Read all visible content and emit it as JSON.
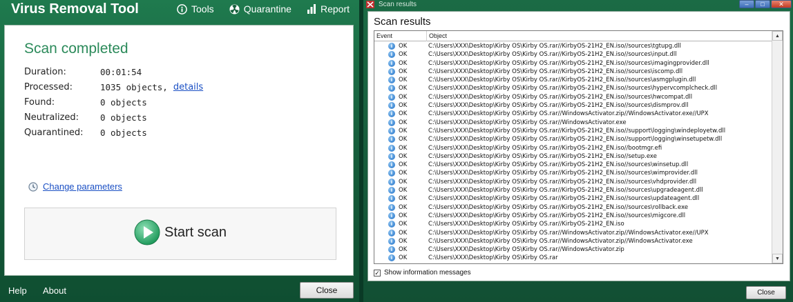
{
  "left_window": {
    "title": "Virus Removal Tool",
    "menu": [
      {
        "icon": "info-circle-icon",
        "label": "Tools"
      },
      {
        "icon": "radiation-icon",
        "label": "Quarantine"
      },
      {
        "icon": "bar-chart-icon",
        "label": "Report"
      }
    ],
    "heading": "Scan completed",
    "stats": [
      {
        "label": "Duration:",
        "value": "00:01:54",
        "link": ""
      },
      {
        "label": "Processed:",
        "value": "1035 objects,",
        "link": "details"
      },
      {
        "label": "Found:",
        "value": "0 objects",
        "link": ""
      },
      {
        "label": "Neutralized:",
        "value": "0 objects",
        "link": ""
      },
      {
        "label": "Quarantined:",
        "value": "0 objects",
        "link": ""
      }
    ],
    "change_parameters": "Change parameters",
    "start_scan": "Start scan",
    "footer": {
      "help": "Help",
      "about": "About",
      "close": "Close"
    },
    "colors": {
      "accent": "#2b8a5a",
      "background": "#17603d",
      "link": "#1a4fc4"
    }
  },
  "right_window": {
    "title": "Scan results",
    "heading": "Scan results",
    "columns": {
      "event": "Event",
      "object": "Object"
    },
    "rows": [
      {
        "event": "OK",
        "object": "C:\\Users\\XXX\\Desktop\\Kirby OS\\Kirby OS.rar//KirbyOS-21H2_EN.iso//sources\\tgtupg.dll"
      },
      {
        "event": "OK",
        "object": "C:\\Users\\XXX\\Desktop\\Kirby OS\\Kirby OS.rar//KirbyOS-21H2_EN.iso//sources\\input.dll"
      },
      {
        "event": "OK",
        "object": "C:\\Users\\XXX\\Desktop\\Kirby OS\\Kirby OS.rar//KirbyOS-21H2_EN.iso//sources\\imagingprovider.dll"
      },
      {
        "event": "OK",
        "object": "C:\\Users\\XXX\\Desktop\\Kirby OS\\Kirby OS.rar//KirbyOS-21H2_EN.iso//sources\\iscomp.dll"
      },
      {
        "event": "OK",
        "object": "C:\\Users\\XXX\\Desktop\\Kirby OS\\Kirby OS.rar//KirbyOS-21H2_EN.iso//sources\\asmgplugin.dll"
      },
      {
        "event": "OK",
        "object": "C:\\Users\\XXX\\Desktop\\Kirby OS\\Kirby OS.rar//KirbyOS-21H2_EN.iso//sources\\hypervcomplcheck.dll"
      },
      {
        "event": "OK",
        "object": "C:\\Users\\XXX\\Desktop\\Kirby OS\\Kirby OS.rar//KirbyOS-21H2_EN.iso//sources\\hwcompat.dll"
      },
      {
        "event": "OK",
        "object": "C:\\Users\\XXX\\Desktop\\Kirby OS\\Kirby OS.rar//KirbyOS-21H2_EN.iso//sources\\dismprov.dll"
      },
      {
        "event": "OK",
        "object": "C:\\Users\\XXX\\Desktop\\Kirby OS\\Kirby OS.rar//WindowsActivator.zip//WindowsActivator.exe//UPX"
      },
      {
        "event": "OK",
        "object": "C:\\Users\\XXX\\Desktop\\Kirby OS\\Kirby OS.rar//WindowsActivator.exe"
      },
      {
        "event": "OK",
        "object": "C:\\Users\\XXX\\Desktop\\Kirby OS\\Kirby OS.rar//KirbyOS-21H2_EN.iso//support\\logging\\windeployetw.dll"
      },
      {
        "event": "OK",
        "object": "C:\\Users\\XXX\\Desktop\\Kirby OS\\Kirby OS.rar//KirbyOS-21H2_EN.iso//support\\logging\\winsetupetw.dll"
      },
      {
        "event": "OK",
        "object": "C:\\Users\\XXX\\Desktop\\Kirby OS\\Kirby OS.rar//KirbyOS-21H2_EN.iso//bootmgr.efi"
      },
      {
        "event": "OK",
        "object": "C:\\Users\\XXX\\Desktop\\Kirby OS\\Kirby OS.rar//KirbyOS-21H2_EN.iso//setup.exe"
      },
      {
        "event": "OK",
        "object": "C:\\Users\\XXX\\Desktop\\Kirby OS\\Kirby OS.rar//KirbyOS-21H2_EN.iso//sources\\winsetup.dll"
      },
      {
        "event": "OK",
        "object": "C:\\Users\\XXX\\Desktop\\Kirby OS\\Kirby OS.rar//KirbyOS-21H2_EN.iso//sources\\wimprovider.dll"
      },
      {
        "event": "OK",
        "object": "C:\\Users\\XXX\\Desktop\\Kirby OS\\Kirby OS.rar//KirbyOS-21H2_EN.iso//sources\\vhdprovider.dll"
      },
      {
        "event": "OK",
        "object": "C:\\Users\\XXX\\Desktop\\Kirby OS\\Kirby OS.rar//KirbyOS-21H2_EN.iso//sources\\upgradeagent.dll"
      },
      {
        "event": "OK",
        "object": "C:\\Users\\XXX\\Desktop\\Kirby OS\\Kirby OS.rar//KirbyOS-21H2_EN.iso//sources\\updateagent.dll"
      },
      {
        "event": "OK",
        "object": "C:\\Users\\XXX\\Desktop\\Kirby OS\\Kirby OS.rar//KirbyOS-21H2_EN.iso//sources\\rollback.exe"
      },
      {
        "event": "OK",
        "object": "C:\\Users\\XXX\\Desktop\\Kirby OS\\Kirby OS.rar//KirbyOS-21H2_EN.iso//sources\\migcore.dll"
      },
      {
        "event": "OK",
        "object": "C:\\Users\\XXX\\Desktop\\Kirby OS\\Kirby OS.rar//KirbyOS-21H2_EN.iso"
      },
      {
        "event": "OK",
        "object": "C:\\Users\\XXX\\Desktop\\Kirby OS\\Kirby OS.rar//WindowsActivator.zip//WindowsActivator.exe//UPX"
      },
      {
        "event": "OK",
        "object": "C:\\Users\\XXX\\Desktop\\Kirby OS\\Kirby OS.rar//WindowsActivator.zip//WindowsActivator.exe"
      },
      {
        "event": "OK",
        "object": "C:\\Users\\XXX\\Desktop\\Kirby OS\\Kirby OS.rar//WindowsActivator.zip"
      },
      {
        "event": "OK",
        "object": "C:\\Users\\XXX\\Desktop\\Kirby OS\\Kirby OS.rar"
      }
    ],
    "show_info_label": "Show information messages",
    "show_info_checked": true,
    "close": "Close",
    "icons": {
      "row": "info-icon",
      "window_buttons": [
        "minimize-icon",
        "maximize-icon",
        "close-icon"
      ]
    }
  }
}
